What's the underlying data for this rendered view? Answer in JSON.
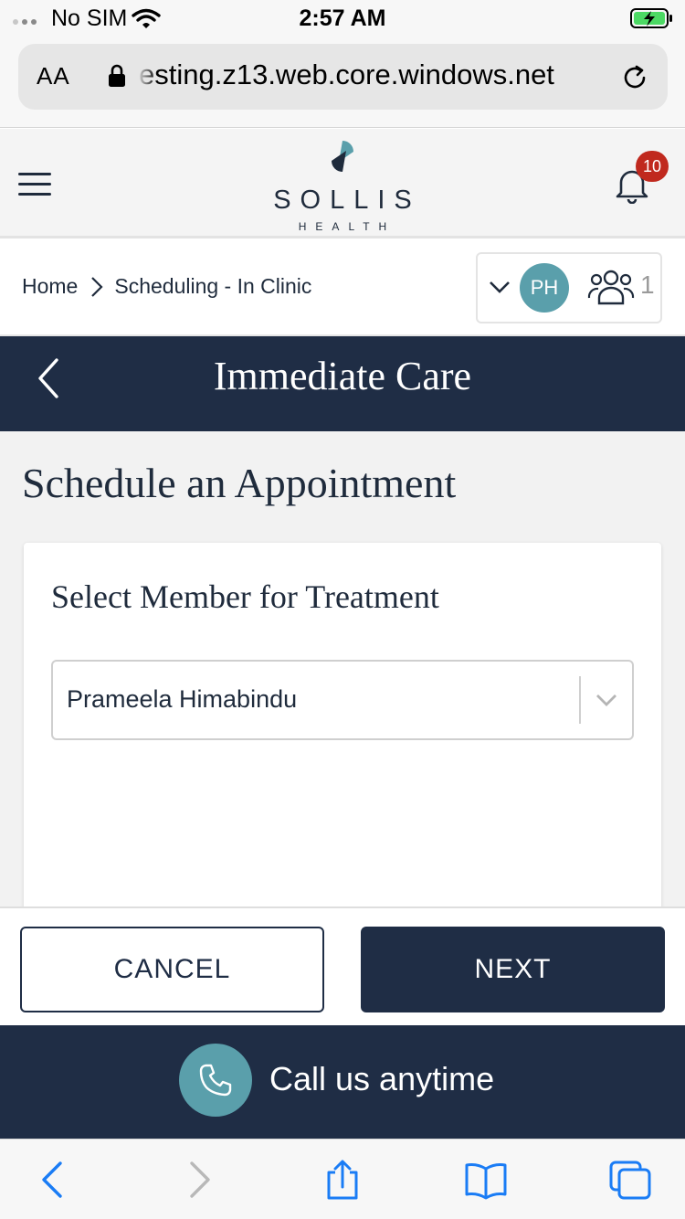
{
  "status_bar": {
    "carrier": "No SIM",
    "time": "2:57 AM",
    "icons": [
      "wifi-icon",
      "battery-charging-icon"
    ]
  },
  "browser": {
    "text_size_label": "AA",
    "url": "esting.z13.web.core.windows.net",
    "icons": [
      "lock-icon",
      "reload-icon"
    ]
  },
  "header": {
    "logo_title": "SOLLIS",
    "logo_subtitle": "HEALTH",
    "notification_count": "10",
    "icons": [
      "menu-icon",
      "bell-icon"
    ]
  },
  "breadcrumb": {
    "home": "Home",
    "current": "Scheduling - In Clinic"
  },
  "member_switcher": {
    "avatar_initials": "PH",
    "member_count": "1"
  },
  "page": {
    "band_title": "Immediate Care",
    "heading": "Schedule an Appointment"
  },
  "card": {
    "title": "Select Member for Treatment",
    "selected_member": "Prameela Himabindu"
  },
  "actions": {
    "cancel_label": "CANCEL",
    "next_label": "NEXT"
  },
  "call_bar": {
    "label": "Call us anytime"
  },
  "toolbar": {
    "icons": [
      "back-arrow-icon",
      "forward-arrow-icon",
      "share-icon",
      "bookmarks-icon",
      "tabs-icon"
    ]
  },
  "colors": {
    "navy": "#1f2d45",
    "teal": "#5a9fab",
    "badge_red": "#c0291e",
    "ios_blue": "#1a7cf5"
  }
}
